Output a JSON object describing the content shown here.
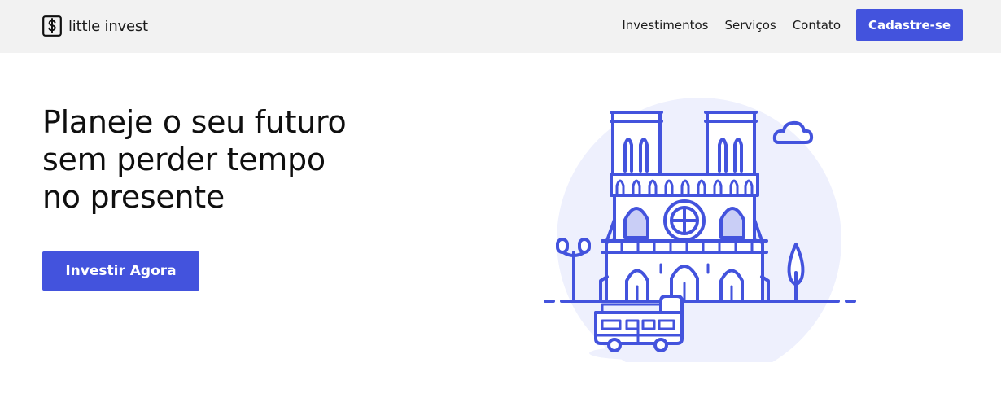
{
  "header": {
    "logo": {
      "text": "little invest",
      "icon": "dollar-box-icon"
    },
    "nav": [
      {
        "label": "Investimentos"
      },
      {
        "label": "Serviços"
      },
      {
        "label": "Contato"
      }
    ],
    "signup_label": "Cadastre-se"
  },
  "hero": {
    "title_lines": [
      "Planeje o seu futuro",
      "sem perder tempo",
      "no presente"
    ],
    "cta_label": "Investir Agora"
  },
  "illustration": {
    "subject": "cathedral-with-bus",
    "icons": [
      "cathedral-icon",
      "cloud-icon",
      "street-lamp-icon",
      "tree-icon",
      "bus-icon"
    ]
  },
  "colors": {
    "accent": "#4353dd",
    "header_bg": "#f2f2f2",
    "illustration_fill": "#eef0fd",
    "illustration_shade": "#c9cef6"
  }
}
